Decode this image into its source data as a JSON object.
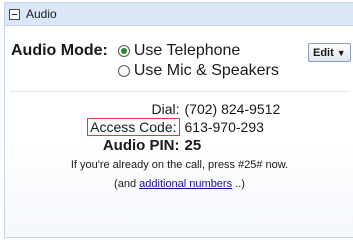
{
  "panel": {
    "title": "Audio"
  },
  "audio_mode": {
    "label": "Audio Mode:",
    "options": [
      "Use Telephone",
      "Use Mic & Speakers"
    ],
    "selected": "Use Telephone",
    "edit_label": "Edit"
  },
  "dial": {
    "label": "Dial:",
    "value": "(702) 824-9512"
  },
  "access_code": {
    "label": "Access Code:",
    "value": "613-970-293"
  },
  "audio_pin": {
    "label": "Audio PIN:",
    "value": "25"
  },
  "note": {
    "text": "If you're already on the call, press #25# now."
  },
  "more": {
    "prefix": "(and",
    "link": "additional numbers",
    "suffix": "..)"
  }
}
